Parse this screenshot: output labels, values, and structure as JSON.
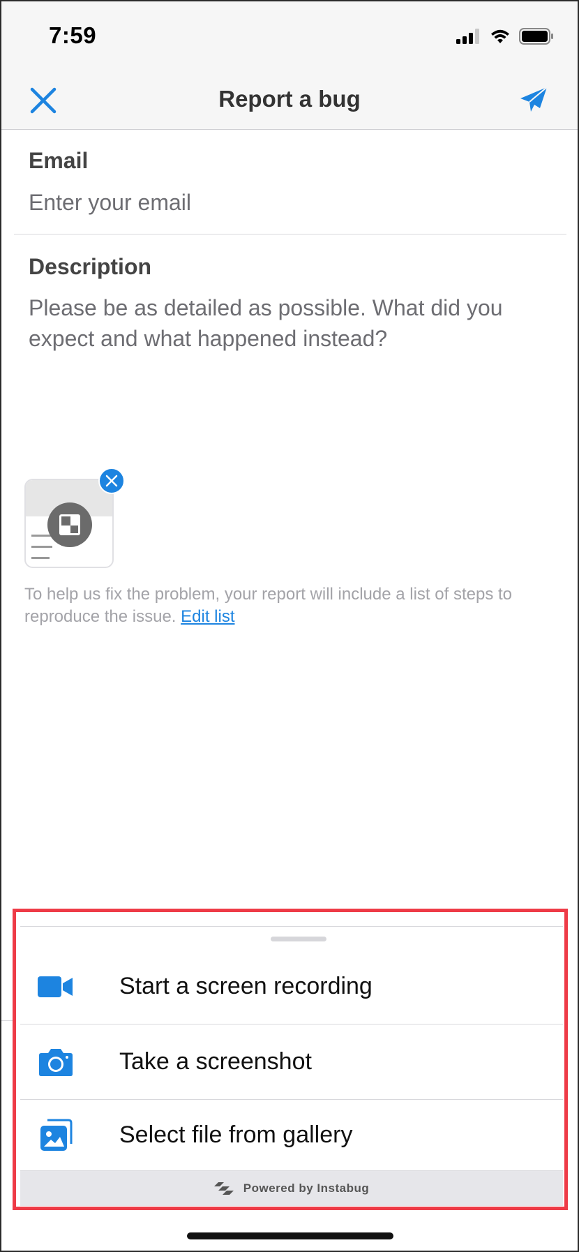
{
  "status_bar": {
    "time": "7:59"
  },
  "nav": {
    "title": "Report a bug"
  },
  "form": {
    "email": {
      "label": "Email",
      "placeholder": "Enter your email",
      "value": ""
    },
    "description": {
      "label": "Description",
      "placeholder": "Please be as detailed as possible. What did you expect and what happened instead?",
      "value": ""
    }
  },
  "repro": {
    "text": "To help us fix the problem, your report will include a list of steps to reproduce the issue.",
    "link": "Edit list"
  },
  "attachment_sheet": {
    "options": [
      {
        "label": "Start a screen recording",
        "icon": "video-camera-icon"
      },
      {
        "label": "Take a screenshot",
        "icon": "camera-icon"
      },
      {
        "label": "Select file from gallery",
        "icon": "gallery-icon"
      }
    ],
    "powered_by": "Powered by Instabug"
  },
  "colors": {
    "accent": "#1d84e0",
    "highlight_border": "#ee3b47",
    "nav_bg": "#f6f6f6"
  }
}
